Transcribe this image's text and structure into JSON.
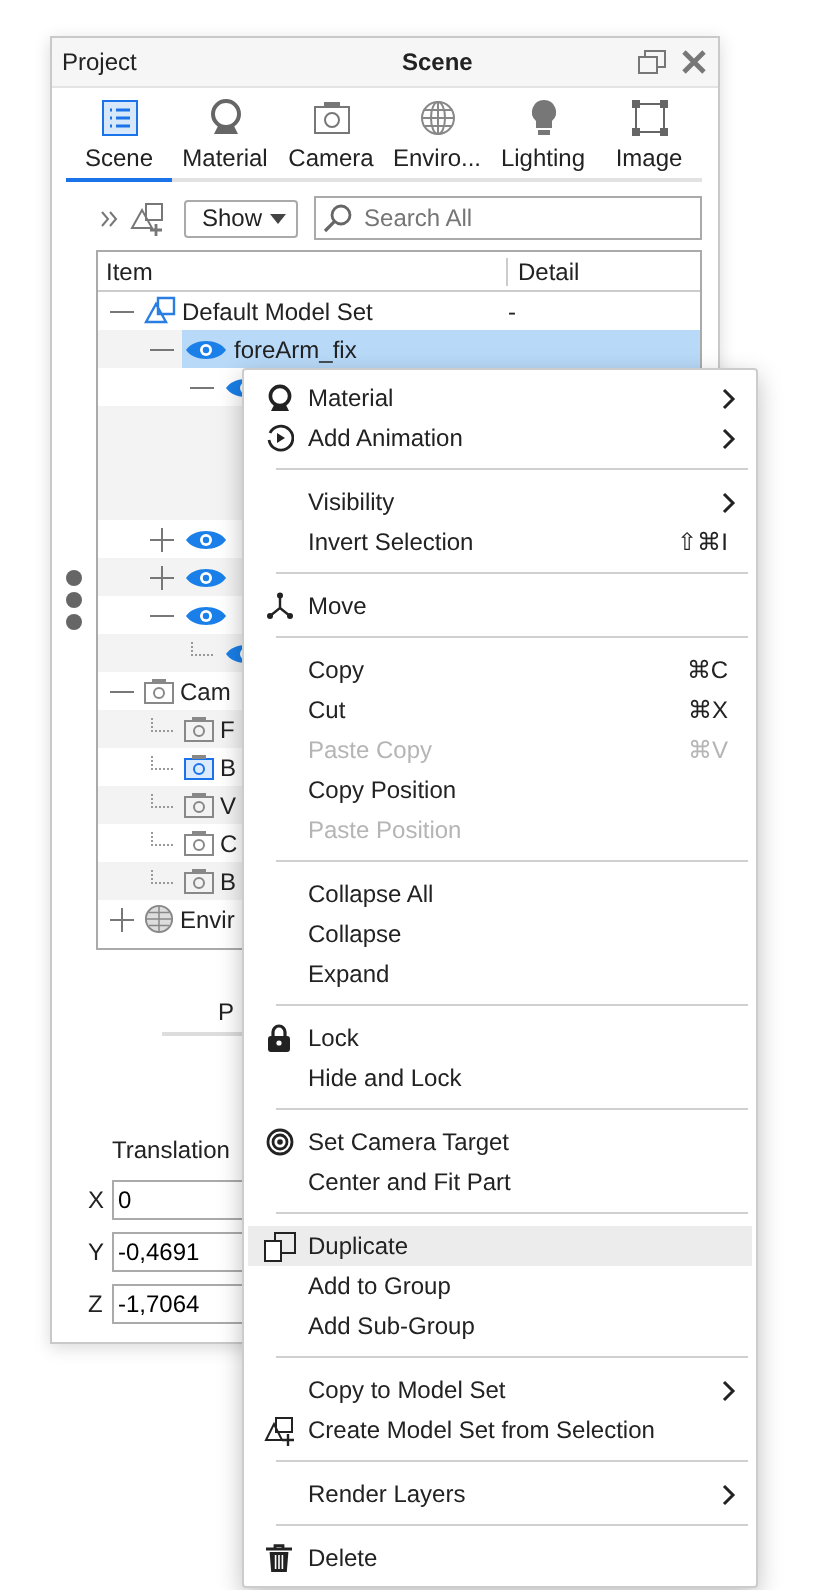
{
  "window": {
    "tab_title": "Project",
    "title": "Scene"
  },
  "tabs": [
    {
      "label": "Scene",
      "selected": true
    },
    {
      "label": "Material",
      "selected": false
    },
    {
      "label": "Camera",
      "selected": false
    },
    {
      "label": "Enviro...",
      "selected": false
    },
    {
      "label": "Lighting",
      "selected": false
    },
    {
      "label": "Image",
      "selected": false
    }
  ],
  "toolbar": {
    "show_button": "Show",
    "search": {
      "placeholder": "Search All"
    }
  },
  "tree": {
    "columns": [
      "Item",
      "Detail"
    ],
    "rows": [
      {
        "kind": "model_set",
        "label": "Default Model Set",
        "detail": "-",
        "expanded": true,
        "children": [
          {
            "kind": "part",
            "label": "foreArm_fix",
            "expanded": true,
            "visible": true,
            "selected": true,
            "children": [
              {
                "kind": "part",
                "expanded": true,
                "visible": true,
                "selected": false,
                "children": [
                  {
                    "kind": "blank"
                  },
                  {
                    "kind": "blank"
                  },
                  {
                    "kind": "blank"
                  }
                ]
              }
            ]
          },
          {
            "kind": "part",
            "expanded": false,
            "visible": true,
            "selected": false
          },
          {
            "kind": "part",
            "expanded": false,
            "visible": true,
            "selected": false
          },
          {
            "kind": "part",
            "expanded": true,
            "visible": true,
            "selected": false,
            "children": [
              {
                "kind": "part",
                "visible": true,
                "selected": false
              }
            ]
          }
        ]
      },
      {
        "kind": "camera_group",
        "label": "Cam",
        "expanded": true,
        "children": [
          {
            "kind": "camera",
            "label": "F",
            "active": false
          },
          {
            "kind": "camera",
            "label": "B",
            "active": true
          },
          {
            "kind": "camera",
            "label": "V",
            "active": false
          },
          {
            "kind": "camera",
            "label": "C",
            "active": false
          },
          {
            "kind": "camera",
            "label": "B",
            "active": false
          }
        ]
      },
      {
        "kind": "environment",
        "label": "Envir",
        "expanded": false
      }
    ]
  },
  "properties_tabs": [
    {
      "label": "P"
    }
  ],
  "translation": {
    "label": "Translation",
    "fields": [
      {
        "axis": "X",
        "value": "0"
      },
      {
        "axis": "Y",
        "value": "-0,4691"
      },
      {
        "axis": "Z",
        "value": "-1,7064"
      }
    ]
  },
  "context_menu": [
    {
      "kind": "item",
      "label": "Material",
      "submenu": true
    },
    {
      "kind": "item",
      "label": "Add Animation",
      "submenu": true
    },
    {
      "kind": "separator"
    },
    {
      "kind": "item",
      "label": "Visibility",
      "submenu": true
    },
    {
      "kind": "item",
      "label": "Invert Selection",
      "shortcut": "⇧⌘I"
    },
    {
      "kind": "separator"
    },
    {
      "kind": "item",
      "label": "Move"
    },
    {
      "kind": "separator"
    },
    {
      "kind": "item",
      "label": "Copy",
      "shortcut": "⌘C",
      "disabled": false
    },
    {
      "kind": "item",
      "label": "Cut",
      "shortcut": "⌘X",
      "disabled": false
    },
    {
      "kind": "item",
      "label": "Paste Copy",
      "shortcut": "⌘V",
      "disabled": true
    },
    {
      "kind": "item",
      "label": "Copy Position",
      "disabled": false
    },
    {
      "kind": "item",
      "label": "Paste Position",
      "disabled": true
    },
    {
      "kind": "separator"
    },
    {
      "kind": "item",
      "label": "Collapse All"
    },
    {
      "kind": "item",
      "label": "Collapse"
    },
    {
      "kind": "item",
      "label": "Expand"
    },
    {
      "kind": "separator"
    },
    {
      "kind": "item",
      "label": "Lock"
    },
    {
      "kind": "item",
      "label": "Hide and Lock"
    },
    {
      "kind": "separator"
    },
    {
      "kind": "item",
      "label": "Set Camera Target"
    },
    {
      "kind": "item",
      "label": "Center and Fit Part"
    },
    {
      "kind": "separator"
    },
    {
      "kind": "item",
      "label": "Duplicate",
      "selected": true
    },
    {
      "kind": "item",
      "label": "Add to Group",
      "selected": false
    },
    {
      "kind": "item",
      "label": "Add Sub-Group",
      "selected": false
    },
    {
      "kind": "separator"
    },
    {
      "kind": "item",
      "label": "Copy to Model Set",
      "submenu": true
    },
    {
      "kind": "item",
      "label": "Create Model Set from Selection"
    },
    {
      "kind": "separator"
    },
    {
      "kind": "item",
      "label": "Render Layers",
      "submenu": true
    },
    {
      "kind": "separator"
    },
    {
      "kind": "item",
      "label": "Delete"
    }
  ]
}
